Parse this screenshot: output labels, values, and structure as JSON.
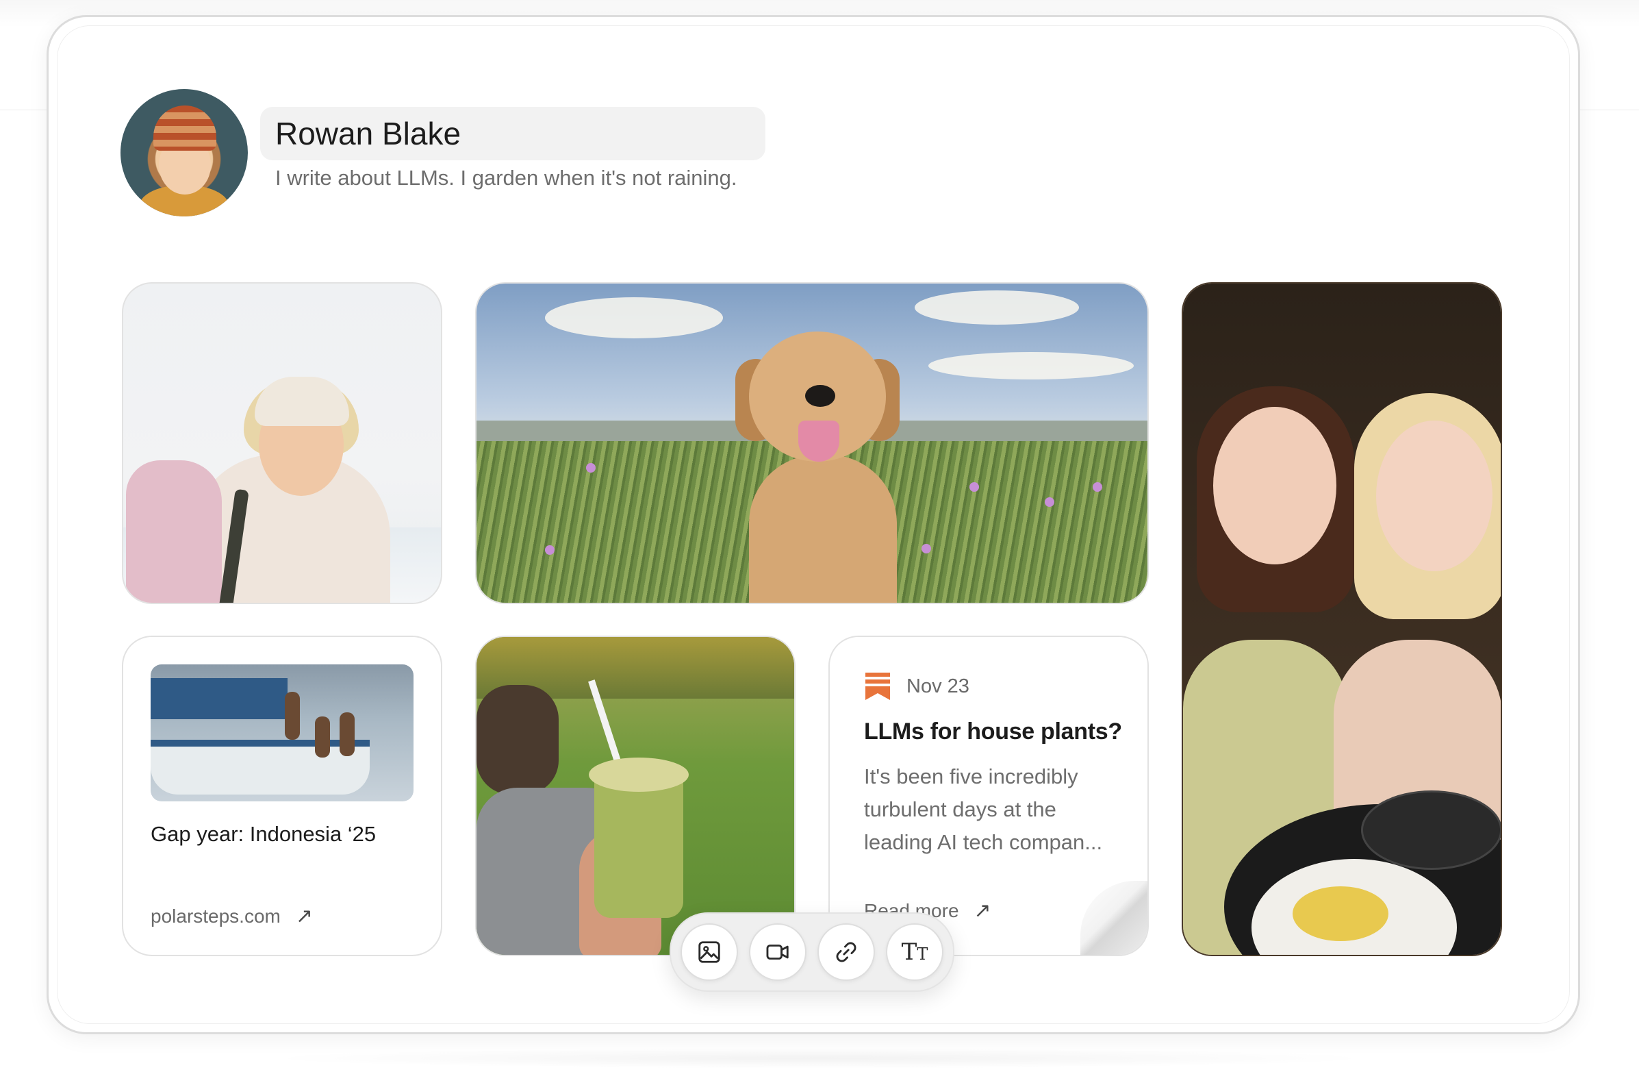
{
  "profile": {
    "name": "Rowan Blake",
    "bio": "I write about LLMs. I garden when it's not raining."
  },
  "cards": {
    "gap_year": {
      "title": "Gap year: Indonesia ‘25",
      "link": "polarsteps.com"
    },
    "post": {
      "date": "Nov 23",
      "title": "LLMs for house plants?",
      "excerpt": "It's been five incredibly turbulent days at the leading AI tech compan...",
      "read_more": "Read more",
      "icon": "bookmark-icon",
      "accent_color": "#e8743b"
    }
  },
  "toolbar": {
    "items": [
      {
        "icon": "image-icon"
      },
      {
        "icon": "video-icon"
      },
      {
        "icon": "link-icon"
      },
      {
        "icon": "text-icon"
      }
    ]
  }
}
